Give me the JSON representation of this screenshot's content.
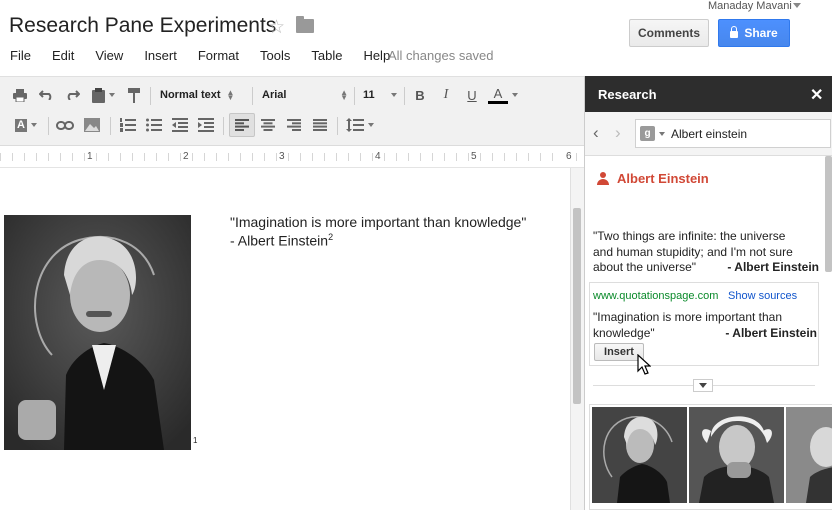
{
  "header": {
    "doc_title": "Research Pane Experiments",
    "user_name": "Manaday Mavani",
    "comments_label": "Comments",
    "share_label": "Share",
    "save_status": "All changes saved"
  },
  "menus": [
    "File",
    "Edit",
    "View",
    "Insert",
    "Format",
    "Tools",
    "Table",
    "Help"
  ],
  "toolbar": {
    "style": "Normal text",
    "font": "Arial",
    "size": "11",
    "bold": "B",
    "italic": "I",
    "underline": "U",
    "text_color_glyph": "A",
    "highlight_glyph": "A"
  },
  "ruler": {
    "marks": [
      "1",
      "2",
      "3",
      "4",
      "5",
      "6"
    ]
  },
  "document": {
    "quote_line1": "\"Imagination is more important than knowledge\"",
    "quote_line2": "- Albert Einstein",
    "footnote_sup": "2",
    "image_footnote": "1"
  },
  "research": {
    "title": "Research",
    "search_value": "Albert einstein",
    "google_letter": "g",
    "entity": "Albert Einstein",
    "quote1": {
      "line1": "\"Two things are infinite: the universe",
      "line2": "and human stupidity; and I'm not sure",
      "line3": "about the universe\"",
      "author": "- Albert Einstein"
    },
    "quote2": {
      "source": "www.quotationspage.com",
      "show_sources": "Show sources",
      "line1": "\"Imagination is more important than",
      "line2": "knowledge\"",
      "author": "- Albert Einstein",
      "insert_label": "Insert"
    }
  },
  "colors": {
    "share_blue": "#4d90fe",
    "entity_red": "#d14836",
    "source_green": "#0a8a2a",
    "pane_header": "#2d2d2d"
  }
}
